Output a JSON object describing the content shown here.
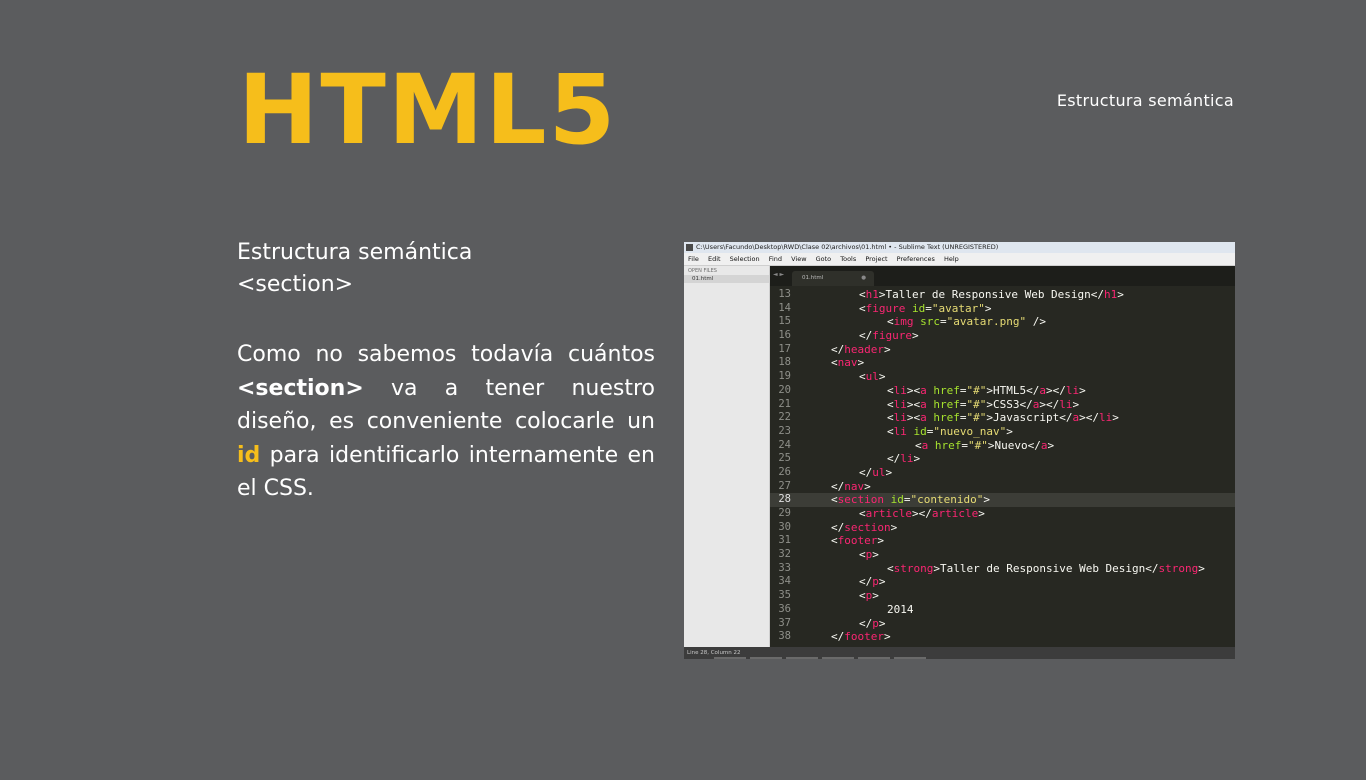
{
  "slide": {
    "title": "HTML5",
    "top_subtitle": "Estructura semántica",
    "section_heading": "Estructura semántica",
    "section_tag": "<section>",
    "body_1": "Como no sabemos todavía cuántos ",
    "body_strong": "<section>",
    "body_2": " va a tener nuestro diseño, es conveniente colocarle un ",
    "body_accent": "id",
    "body_3": " para identificarlo internamente en el CSS.",
    "colors": {
      "background": "#5b5c5e",
      "accent": "#f6be1b",
      "text": "#ffffff"
    }
  },
  "editor": {
    "window_title": "C:\\Users\\Facundo\\Desktop\\RWD\\Clase 02\\archivos\\01.html • - Sublime Text (UNREGISTERED)",
    "menu": [
      "File",
      "Edit",
      "Selection",
      "Find",
      "View",
      "Goto",
      "Tools",
      "Project",
      "Preferences",
      "Help"
    ],
    "sidebar_label": "OPEN FILES",
    "sidebar_file": "01.html",
    "tab_arrows": "◄ ►",
    "tab_label": "01.html",
    "tab_dot": "●",
    "status": "Line 28, Column 22",
    "highlighted_line": 28,
    "colors": {
      "background": "#272822",
      "tag": "#f92672",
      "attr": "#a6e22e",
      "string": "#e6db74",
      "text": "#f8f8f2"
    },
    "lines": [
      {
        "n": "13",
        "indent": 2,
        "tokens": [
          [
            "p",
            "<"
          ],
          [
            "tag",
            "h1"
          ],
          [
            "p",
            ">Taller de Responsive Web Design</"
          ],
          [
            "tag",
            "h1"
          ],
          [
            "p",
            ">"
          ]
        ]
      },
      {
        "n": "14",
        "indent": 2,
        "tokens": [
          [
            "p",
            "<"
          ],
          [
            "tag",
            "figure"
          ],
          [
            "p",
            " "
          ],
          [
            "attr",
            "id"
          ],
          [
            "p",
            "="
          ],
          [
            "str",
            "\"avatar\""
          ],
          [
            "p",
            ">"
          ]
        ]
      },
      {
        "n": "15",
        "indent": 3,
        "tokens": [
          [
            "p",
            "<"
          ],
          [
            "tag",
            "img"
          ],
          [
            "p",
            " "
          ],
          [
            "attr",
            "src"
          ],
          [
            "p",
            "="
          ],
          [
            "str",
            "\"avatar.png\""
          ],
          [
            "p",
            " />"
          ]
        ]
      },
      {
        "n": "16",
        "indent": 2,
        "tokens": [
          [
            "p",
            "</"
          ],
          [
            "tag",
            "figure"
          ],
          [
            "p",
            ">"
          ]
        ]
      },
      {
        "n": "17",
        "indent": 1,
        "tokens": [
          [
            "p",
            "</"
          ],
          [
            "tag",
            "header"
          ],
          [
            "p",
            ">"
          ]
        ]
      },
      {
        "n": "18",
        "indent": 1,
        "tokens": [
          [
            "p",
            "<"
          ],
          [
            "tag",
            "nav"
          ],
          [
            "p",
            ">"
          ]
        ]
      },
      {
        "n": "19",
        "indent": 2,
        "tokens": [
          [
            "p",
            "<"
          ],
          [
            "tag",
            "ul"
          ],
          [
            "p",
            ">"
          ]
        ]
      },
      {
        "n": "20",
        "indent": 3,
        "tokens": [
          [
            "p",
            "<"
          ],
          [
            "tag",
            "li"
          ],
          [
            "p",
            "><"
          ],
          [
            "tag",
            "a"
          ],
          [
            "p",
            " "
          ],
          [
            "attr",
            "href"
          ],
          [
            "p",
            "="
          ],
          [
            "str",
            "\"#\""
          ],
          [
            "p",
            ">HTML5</"
          ],
          [
            "tag",
            "a"
          ],
          [
            "p",
            "></"
          ],
          [
            "tag",
            "li"
          ],
          [
            "p",
            ">"
          ]
        ]
      },
      {
        "n": "21",
        "indent": 3,
        "tokens": [
          [
            "p",
            "<"
          ],
          [
            "tag",
            "li"
          ],
          [
            "p",
            "><"
          ],
          [
            "tag",
            "a"
          ],
          [
            "p",
            " "
          ],
          [
            "attr",
            "href"
          ],
          [
            "p",
            "="
          ],
          [
            "str",
            "\"#\""
          ],
          [
            "p",
            ">CSS3</"
          ],
          [
            "tag",
            "a"
          ],
          [
            "p",
            "></"
          ],
          [
            "tag",
            "li"
          ],
          [
            "p",
            ">"
          ]
        ]
      },
      {
        "n": "22",
        "indent": 3,
        "tokens": [
          [
            "p",
            "<"
          ],
          [
            "tag",
            "li"
          ],
          [
            "p",
            "><"
          ],
          [
            "tag",
            "a"
          ],
          [
            "p",
            " "
          ],
          [
            "attr",
            "href"
          ],
          [
            "p",
            "="
          ],
          [
            "str",
            "\"#\""
          ],
          [
            "p",
            ">Javascript</"
          ],
          [
            "tag",
            "a"
          ],
          [
            "p",
            "></"
          ],
          [
            "tag",
            "li"
          ],
          [
            "p",
            ">"
          ]
        ]
      },
      {
        "n": "23",
        "indent": 3,
        "tokens": [
          [
            "p",
            "<"
          ],
          [
            "tag",
            "li"
          ],
          [
            "p",
            " "
          ],
          [
            "attr",
            "id"
          ],
          [
            "p",
            "="
          ],
          [
            "str",
            "\"nuevo_nav\""
          ],
          [
            "p",
            ">"
          ]
        ]
      },
      {
        "n": "24",
        "indent": 4,
        "tokens": [
          [
            "p",
            "<"
          ],
          [
            "tag",
            "a"
          ],
          [
            "p",
            " "
          ],
          [
            "attr",
            "href"
          ],
          [
            "p",
            "="
          ],
          [
            "str",
            "\"#\""
          ],
          [
            "p",
            ">Nuevo</"
          ],
          [
            "tag",
            "a"
          ],
          [
            "p",
            ">"
          ]
        ]
      },
      {
        "n": "25",
        "indent": 3,
        "tokens": [
          [
            "p",
            "</"
          ],
          [
            "tag",
            "li"
          ],
          [
            "p",
            ">"
          ]
        ]
      },
      {
        "n": "26",
        "indent": 2,
        "tokens": [
          [
            "p",
            "</"
          ],
          [
            "tag",
            "ul"
          ],
          [
            "p",
            ">"
          ]
        ]
      },
      {
        "n": "27",
        "indent": 1,
        "tokens": [
          [
            "p",
            "</"
          ],
          [
            "tag",
            "nav"
          ],
          [
            "p",
            ">"
          ]
        ]
      },
      {
        "n": "28",
        "indent": 1,
        "tokens": [
          [
            "p",
            "<"
          ],
          [
            "tag",
            "section"
          ],
          [
            "p",
            " "
          ],
          [
            "attr",
            "id"
          ],
          [
            "p",
            "="
          ],
          [
            "str",
            "\"contenido\""
          ],
          [
            "p",
            ">"
          ]
        ]
      },
      {
        "n": "29",
        "indent": 2,
        "tokens": [
          [
            "p",
            "<"
          ],
          [
            "tag",
            "article"
          ],
          [
            "p",
            "></"
          ],
          [
            "tag",
            "article"
          ],
          [
            "p",
            ">"
          ]
        ]
      },
      {
        "n": "30",
        "indent": 1,
        "tokens": [
          [
            "p",
            "</"
          ],
          [
            "tag",
            "section"
          ],
          [
            "p",
            ">"
          ]
        ]
      },
      {
        "n": "31",
        "indent": 1,
        "tokens": [
          [
            "p",
            "<"
          ],
          [
            "tag",
            "footer"
          ],
          [
            "p",
            ">"
          ]
        ]
      },
      {
        "n": "32",
        "indent": 2,
        "tokens": [
          [
            "p",
            "<"
          ],
          [
            "tag",
            "p"
          ],
          [
            "p",
            ">"
          ]
        ]
      },
      {
        "n": "33",
        "indent": 3,
        "tokens": [
          [
            "p",
            "<"
          ],
          [
            "tag",
            "strong"
          ],
          [
            "p",
            ">Taller de Responsive Web Design</"
          ],
          [
            "tag",
            "strong"
          ],
          [
            "p",
            ">"
          ]
        ]
      },
      {
        "n": "34",
        "indent": 2,
        "tokens": [
          [
            "p",
            "</"
          ],
          [
            "tag",
            "p"
          ],
          [
            "p",
            ">"
          ]
        ]
      },
      {
        "n": "35",
        "indent": 2,
        "tokens": [
          [
            "p",
            "<"
          ],
          [
            "tag",
            "p"
          ],
          [
            "p",
            ">"
          ]
        ]
      },
      {
        "n": "36",
        "indent": 3,
        "tokens": [
          [
            "p",
            "2014"
          ]
        ]
      },
      {
        "n": "37",
        "indent": 2,
        "tokens": [
          [
            "p",
            "</"
          ],
          [
            "tag",
            "p"
          ],
          [
            "p",
            ">"
          ]
        ]
      },
      {
        "n": "38",
        "indent": 1,
        "tokens": [
          [
            "p",
            "</"
          ],
          [
            "tag",
            "footer"
          ],
          [
            "p",
            ">"
          ]
        ]
      }
    ]
  }
}
